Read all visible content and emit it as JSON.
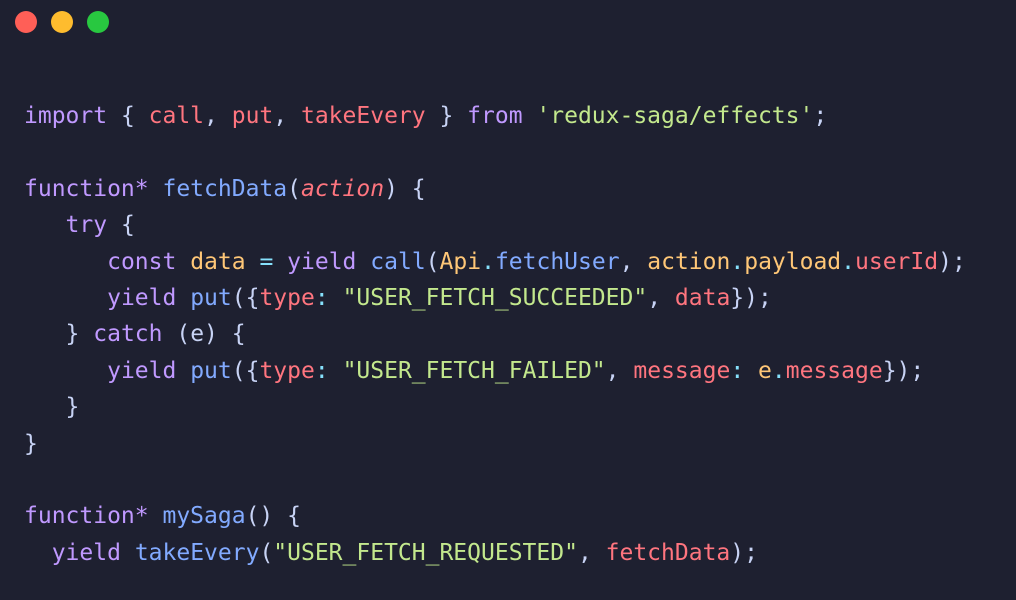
{
  "window": {
    "controls": [
      "close",
      "minimize",
      "maximize"
    ],
    "colors": {
      "background": "#1e2030",
      "close": "#ff5f57",
      "minimize": "#febc2e",
      "maximize": "#28c840"
    }
  },
  "code": {
    "language": "javascript",
    "lines": [
      [
        [
          "kw",
          "import"
        ],
        [
          "punc",
          " { "
        ],
        [
          "var",
          "call"
        ],
        [
          "punc",
          ", "
        ],
        [
          "var",
          "put"
        ],
        [
          "punc",
          ", "
        ],
        [
          "var",
          "takeEvery"
        ],
        [
          "punc",
          " } "
        ],
        [
          "kw",
          "from"
        ],
        [
          "punc",
          " "
        ],
        [
          "str",
          "'redux-saga/effects'"
        ],
        [
          "punc",
          ";"
        ]
      ],
      [],
      [
        [
          "kw",
          "function*"
        ],
        [
          "punc",
          " "
        ],
        [
          "fn",
          "fetchData"
        ],
        [
          "punc",
          "("
        ],
        [
          "param",
          "action"
        ],
        [
          "punc",
          ") {"
        ]
      ],
      [
        [
          "punc",
          "   "
        ],
        [
          "kw",
          "try"
        ],
        [
          "punc",
          " {"
        ]
      ],
      [
        [
          "punc",
          "      "
        ],
        [
          "kw",
          "const"
        ],
        [
          "punc",
          " "
        ],
        [
          "obj",
          "data"
        ],
        [
          "punc",
          " "
        ],
        [
          "op",
          "="
        ],
        [
          "punc",
          " "
        ],
        [
          "kw",
          "yield"
        ],
        [
          "punc",
          " "
        ],
        [
          "fn",
          "call"
        ],
        [
          "punc",
          "("
        ],
        [
          "obj",
          "Api"
        ],
        [
          "op",
          "."
        ],
        [
          "fn",
          "fetchUser"
        ],
        [
          "punc",
          ", "
        ],
        [
          "obj",
          "action"
        ],
        [
          "op",
          "."
        ],
        [
          "obj",
          "payload"
        ],
        [
          "op",
          "."
        ],
        [
          "prop",
          "userId"
        ],
        [
          "punc",
          ");"
        ]
      ],
      [
        [
          "punc",
          "      "
        ],
        [
          "kw",
          "yield"
        ],
        [
          "punc",
          " "
        ],
        [
          "fn",
          "put"
        ],
        [
          "punc",
          "({"
        ],
        [
          "prop",
          "type"
        ],
        [
          "op",
          ":"
        ],
        [
          "punc",
          " "
        ],
        [
          "str",
          "\"USER_FETCH_SUCCEEDED\""
        ],
        [
          "punc",
          ", "
        ],
        [
          "prop",
          "data"
        ],
        [
          "punc",
          "});"
        ]
      ],
      [
        [
          "punc",
          "   } "
        ],
        [
          "kw",
          "catch"
        ],
        [
          "punc",
          " (e) {"
        ]
      ],
      [
        [
          "punc",
          "      "
        ],
        [
          "kw",
          "yield"
        ],
        [
          "punc",
          " "
        ],
        [
          "fn",
          "put"
        ],
        [
          "punc",
          "({"
        ],
        [
          "prop",
          "type"
        ],
        [
          "op",
          ":"
        ],
        [
          "punc",
          " "
        ],
        [
          "str",
          "\"USER_FETCH_FAILED\""
        ],
        [
          "punc",
          ", "
        ],
        [
          "prop",
          "message"
        ],
        [
          "op",
          ":"
        ],
        [
          "punc",
          " "
        ],
        [
          "obj",
          "e"
        ],
        [
          "op",
          "."
        ],
        [
          "prop",
          "message"
        ],
        [
          "punc",
          "});"
        ]
      ],
      [
        [
          "punc",
          "   }"
        ]
      ],
      [
        [
          "punc",
          "}"
        ]
      ],
      [],
      [
        [
          "kw",
          "function*"
        ],
        [
          "punc",
          " "
        ],
        [
          "fn",
          "mySaga"
        ],
        [
          "punc",
          "() {"
        ]
      ],
      [
        [
          "punc",
          "  "
        ],
        [
          "kw",
          "yield"
        ],
        [
          "punc",
          " "
        ],
        [
          "fn",
          "takeEvery"
        ],
        [
          "punc",
          "("
        ],
        [
          "str",
          "\"USER_FETCH_REQUESTED\""
        ],
        [
          "punc",
          ", "
        ],
        [
          "var",
          "fetchData"
        ],
        [
          "punc",
          ");"
        ]
      ]
    ]
  }
}
